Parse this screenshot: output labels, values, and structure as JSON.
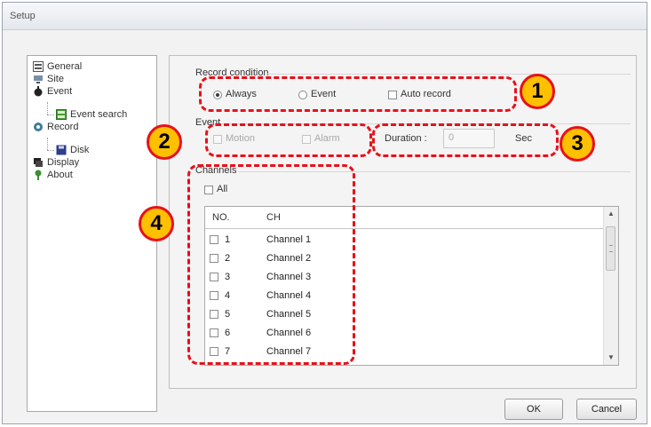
{
  "window": {
    "title": "Setup"
  },
  "sidebar": {
    "items": [
      {
        "label": "General",
        "icon": "general-icon"
      },
      {
        "label": "Site",
        "icon": "site-icon"
      },
      {
        "label": "Event",
        "icon": "event-icon"
      },
      {
        "label": "Event search",
        "icon": "event-search-icon"
      },
      {
        "label": "Record",
        "icon": "record-icon"
      },
      {
        "label": "Disk",
        "icon": "disk-icon"
      },
      {
        "label": "Display",
        "icon": "display-icon"
      },
      {
        "label": "About",
        "icon": "about-icon"
      }
    ]
  },
  "record_condition": {
    "label": "Record condition",
    "options": [
      {
        "label": "Always",
        "selected": true
      },
      {
        "label": "Event",
        "selected": false
      }
    ],
    "auto_record": {
      "label": "Auto record",
      "checked": false
    }
  },
  "event": {
    "label": "Event",
    "motion": {
      "label": "Motion",
      "enabled": false
    },
    "alarm": {
      "label": "Alarm",
      "enabled": false
    },
    "duration_label": "Duration :",
    "duration_value": "0",
    "duration_unit": "Sec"
  },
  "channels": {
    "label": "Channels",
    "all_label": "All",
    "columns": [
      "NO.",
      "CH"
    ],
    "rows": [
      {
        "no": "1",
        "ch": "Channel 1"
      },
      {
        "no": "2",
        "ch": "Channel 2"
      },
      {
        "no": "3",
        "ch": "Channel 3"
      },
      {
        "no": "4",
        "ch": "Channel 4"
      },
      {
        "no": "5",
        "ch": "Channel 5"
      },
      {
        "no": "6",
        "ch": "Channel 6"
      },
      {
        "no": "7",
        "ch": "Channel 7"
      }
    ]
  },
  "buttons": {
    "ok": "OK",
    "cancel": "Cancel"
  },
  "callouts": [
    "1",
    "2",
    "3",
    "4"
  ],
  "colors": {
    "callout_border": "#e8101a",
    "callout_fill": "#ffc000"
  }
}
